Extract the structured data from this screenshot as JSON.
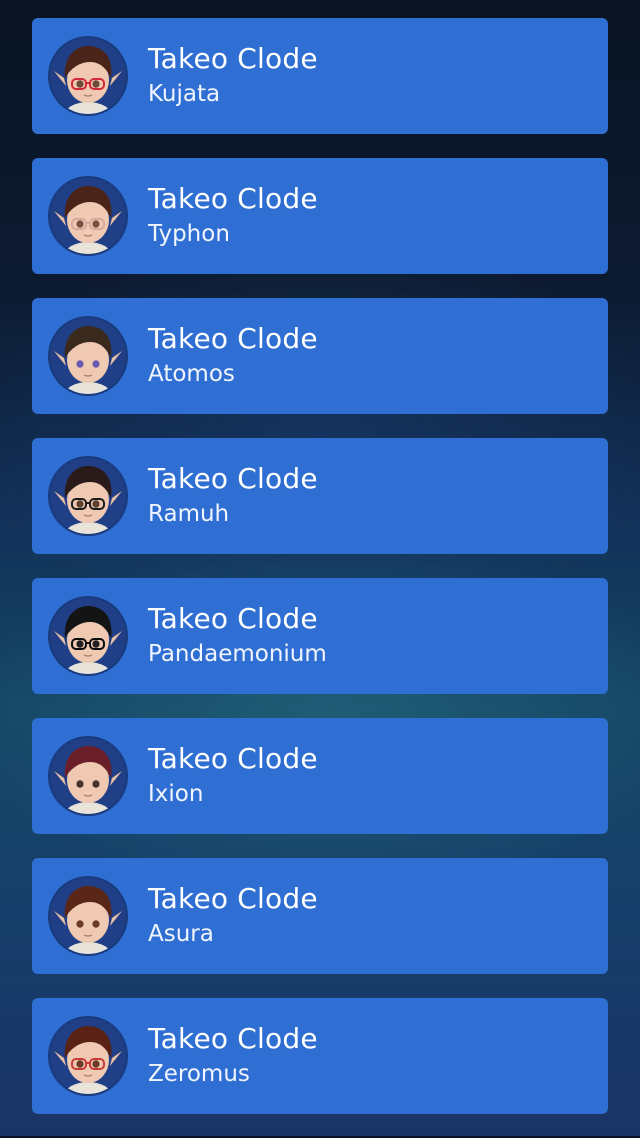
{
  "characters": [
    {
      "name": "Takeo Clode",
      "world": "Kujata",
      "hair": "#4a2418",
      "glasses": "#d02a3a",
      "eyes": "#6b4a3a"
    },
    {
      "name": "Takeo Clode",
      "world": "Typhon",
      "hair": "#4a2418",
      "glasses": "#d8a8a0",
      "eyes": "#7a5040"
    },
    {
      "name": "Takeo Clode",
      "world": "Atomos",
      "hair": "#3a2a1e",
      "glasses": "",
      "eyes": "#6a5ab0"
    },
    {
      "name": "Takeo Clode",
      "world": "Ramuh",
      "hair": "#2a1a1a",
      "glasses": "#1a1a1a",
      "eyes": "#5a4030"
    },
    {
      "name": "Takeo Clode",
      "world": "Pandaemonium",
      "hair": "#141414",
      "glasses": "#0c0c0c",
      "eyes": "#202020"
    },
    {
      "name": "Takeo Clode",
      "world": "Ixion",
      "hair": "#6a1f28",
      "glasses": "",
      "eyes": "#4a3026"
    },
    {
      "name": "Takeo Clode",
      "world": "Asura",
      "hair": "#5a2618",
      "glasses": "",
      "eyes": "#6a3a2a"
    },
    {
      "name": "Takeo Clode",
      "world": "Zeromus",
      "hair": "#5a2214",
      "glasses": "#c83a3a",
      "eyes": "#6a3a2a"
    }
  ]
}
